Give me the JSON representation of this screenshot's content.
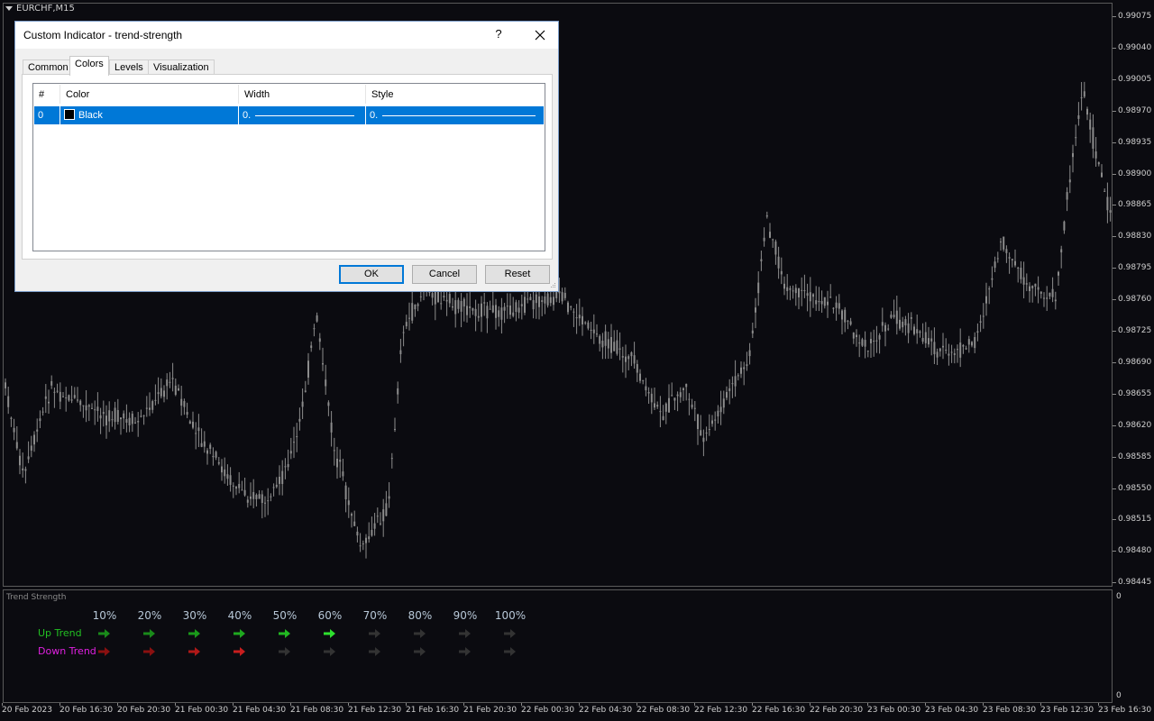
{
  "chart": {
    "symbol": "EURCHF,M15",
    "price_axis": [
      "0.99075",
      "0.99040",
      "0.99005",
      "0.98970",
      "0.98935",
      "0.98900",
      "0.98865",
      "0.98830",
      "0.98795",
      "0.98760",
      "0.98725",
      "0.98690",
      "0.98655",
      "0.98620",
      "0.98585",
      "0.98550",
      "0.98515",
      "0.98480",
      "0.98445"
    ],
    "time_axis": [
      "20 Feb 2023",
      "20 Feb 16:30",
      "20 Feb 20:30",
      "21 Feb 00:30",
      "21 Feb 04:30",
      "21 Feb 08:30",
      "21 Feb 12:30",
      "21 Feb 16:30",
      "21 Feb 20:30",
      "22 Feb 00:30",
      "22 Feb 04:30",
      "22 Feb 08:30",
      "22 Feb 12:30",
      "22 Feb 16:30",
      "22 Feb 20:30",
      "23 Feb 00:30",
      "23 Feb 04:30",
      "23 Feb 08:30",
      "23 Feb 12:30",
      "23 Feb 16:30"
    ],
    "candle_color": "#8c8c8c"
  },
  "indicator": {
    "title": "Trend Strength",
    "scale_top": "0",
    "scale_bottom": "0",
    "percent_labels": [
      "10%",
      "20%",
      "30%",
      "40%",
      "50%",
      "60%",
      "70%",
      "80%",
      "90%",
      "100%"
    ],
    "up_label": "Up Trend",
    "down_label": "Down Trend",
    "up_color": "#22c022",
    "down_color": "#e020e0",
    "up_levels": [
      "#1a8a1a",
      "#1a8a1a",
      "#1a991a",
      "#1fa81f",
      "#22b822",
      "#2ee02e",
      "#333333",
      "#333333",
      "#333333",
      "#333333"
    ],
    "down_levels": [
      "#8a1010",
      "#8a1010",
      "#b01818",
      "#c81e1e",
      "#333333",
      "#333333",
      "#333333",
      "#333333",
      "#333333",
      "#333333"
    ]
  },
  "dialog": {
    "title": "Custom Indicator - trend-strength",
    "help": "?",
    "tabs": [
      "Common",
      "Colors",
      "Levels",
      "Visualization"
    ],
    "active_tab": "Colors",
    "columns": [
      "#",
      "Color",
      "Width",
      "Style"
    ],
    "rows": [
      {
        "index": "0",
        "color_name": "Black",
        "width": "0.",
        "style": "0."
      }
    ],
    "buttons": {
      "ok": "OK",
      "cancel": "Cancel",
      "reset": "Reset"
    }
  }
}
